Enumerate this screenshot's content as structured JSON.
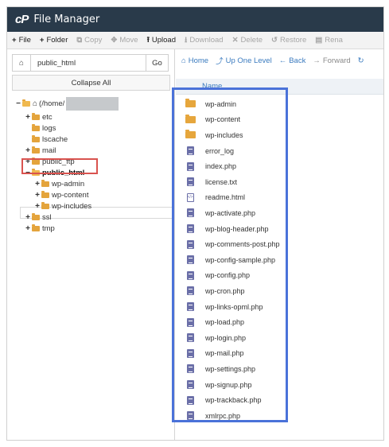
{
  "app": {
    "title": "File Manager",
    "logo": "cP"
  },
  "toolbar": {
    "file": "File",
    "folder": "Folder",
    "copy": "Copy",
    "move": "Move",
    "upload": "Upload",
    "download": "Download",
    "delete": "Delete",
    "restore": "Restore",
    "rename": "Rena"
  },
  "path": {
    "value": "public_html",
    "go": "Go"
  },
  "tree": {
    "collapse_all": "Collapse All",
    "root_label": "(/home/",
    "items": {
      "etc": "etc",
      "logs": "logs",
      "lscache": "lscache",
      "mail": "mail",
      "public_ftp": "public_ftp",
      "public_html": "public_html",
      "wp_admin": "wp-admin",
      "wp_content": "wp-content",
      "wp_includes": "wp-includes",
      "ssl": "ssl",
      "tmp": "tmp"
    }
  },
  "nav": {
    "home": "Home",
    "up": "Up One Level",
    "back": "Back",
    "forward": "Forward"
  },
  "list": {
    "header": "Name",
    "files": [
      {
        "name": "wp-admin",
        "type": "folder"
      },
      {
        "name": "wp-content",
        "type": "folder"
      },
      {
        "name": "wp-includes",
        "type": "folder"
      },
      {
        "name": "error_log",
        "type": "doc"
      },
      {
        "name": "index.php",
        "type": "doc"
      },
      {
        "name": "license.txt",
        "type": "doc"
      },
      {
        "name": "readme.html",
        "type": "html"
      },
      {
        "name": "wp-activate.php",
        "type": "doc"
      },
      {
        "name": "wp-blog-header.php",
        "type": "doc"
      },
      {
        "name": "wp-comments-post.php",
        "type": "doc"
      },
      {
        "name": "wp-config-sample.php",
        "type": "doc"
      },
      {
        "name": "wp-config.php",
        "type": "doc"
      },
      {
        "name": "wp-cron.php",
        "type": "doc"
      },
      {
        "name": "wp-links-opml.php",
        "type": "doc"
      },
      {
        "name": "wp-load.php",
        "type": "doc"
      },
      {
        "name": "wp-login.php",
        "type": "doc"
      },
      {
        "name": "wp-mail.php",
        "type": "doc"
      },
      {
        "name": "wp-settings.php",
        "type": "doc"
      },
      {
        "name": "wp-signup.php",
        "type": "doc"
      },
      {
        "name": "wp-trackback.php",
        "type": "doc"
      },
      {
        "name": "xmlrpc.php",
        "type": "doc"
      }
    ]
  },
  "colors": {
    "titlebar": "#293a4a",
    "link": "#3b7bbf",
    "folder": "#e4a43c",
    "doc_icon": "#6b6fa8",
    "highlight_red": "#d9534f",
    "highlight_blue": "#4a72d9"
  }
}
